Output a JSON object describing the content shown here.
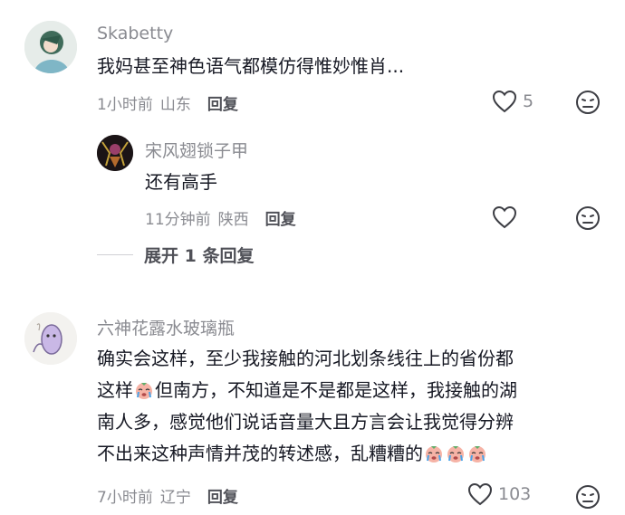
{
  "comments": [
    {
      "username": "Skabetty",
      "text": "我妈甚至神色语气都模仿得惟妙惟肖...",
      "time": "1小时前",
      "location": "山东",
      "reply_label": "回复",
      "likes": "5",
      "replies": [
        {
          "username": "宋风翅锁子甲",
          "text": "还有高手",
          "time": "11分钟前",
          "location": "陕西",
          "reply_label": "回复",
          "likes": ""
        }
      ],
      "expand_label": "展开 1 条回复"
    },
    {
      "username": "六神花露水玻璃瓶",
      "text_lines": [
        "确实会这样，至少我接触的河北划条线往上的省份都",
        "这样",
        "但南方，不知道是不是都是这样，我接触的湖",
        "南人多，感觉他们说话音量大且方言会让我觉得分辨",
        "不出来这种声情并茂的转述感，乱糟糟的"
      ],
      "time": "7小时前",
      "location": "辽宁",
      "reply_label": "回复",
      "likes": "103"
    }
  ],
  "icons": {
    "like": "heart-outline-icon",
    "dislike": "dislike-face-icon",
    "emoji": "crying-face-emoji"
  },
  "colors": {
    "text": "#161823",
    "muted": "#8a8b91",
    "reply": "#505158"
  }
}
